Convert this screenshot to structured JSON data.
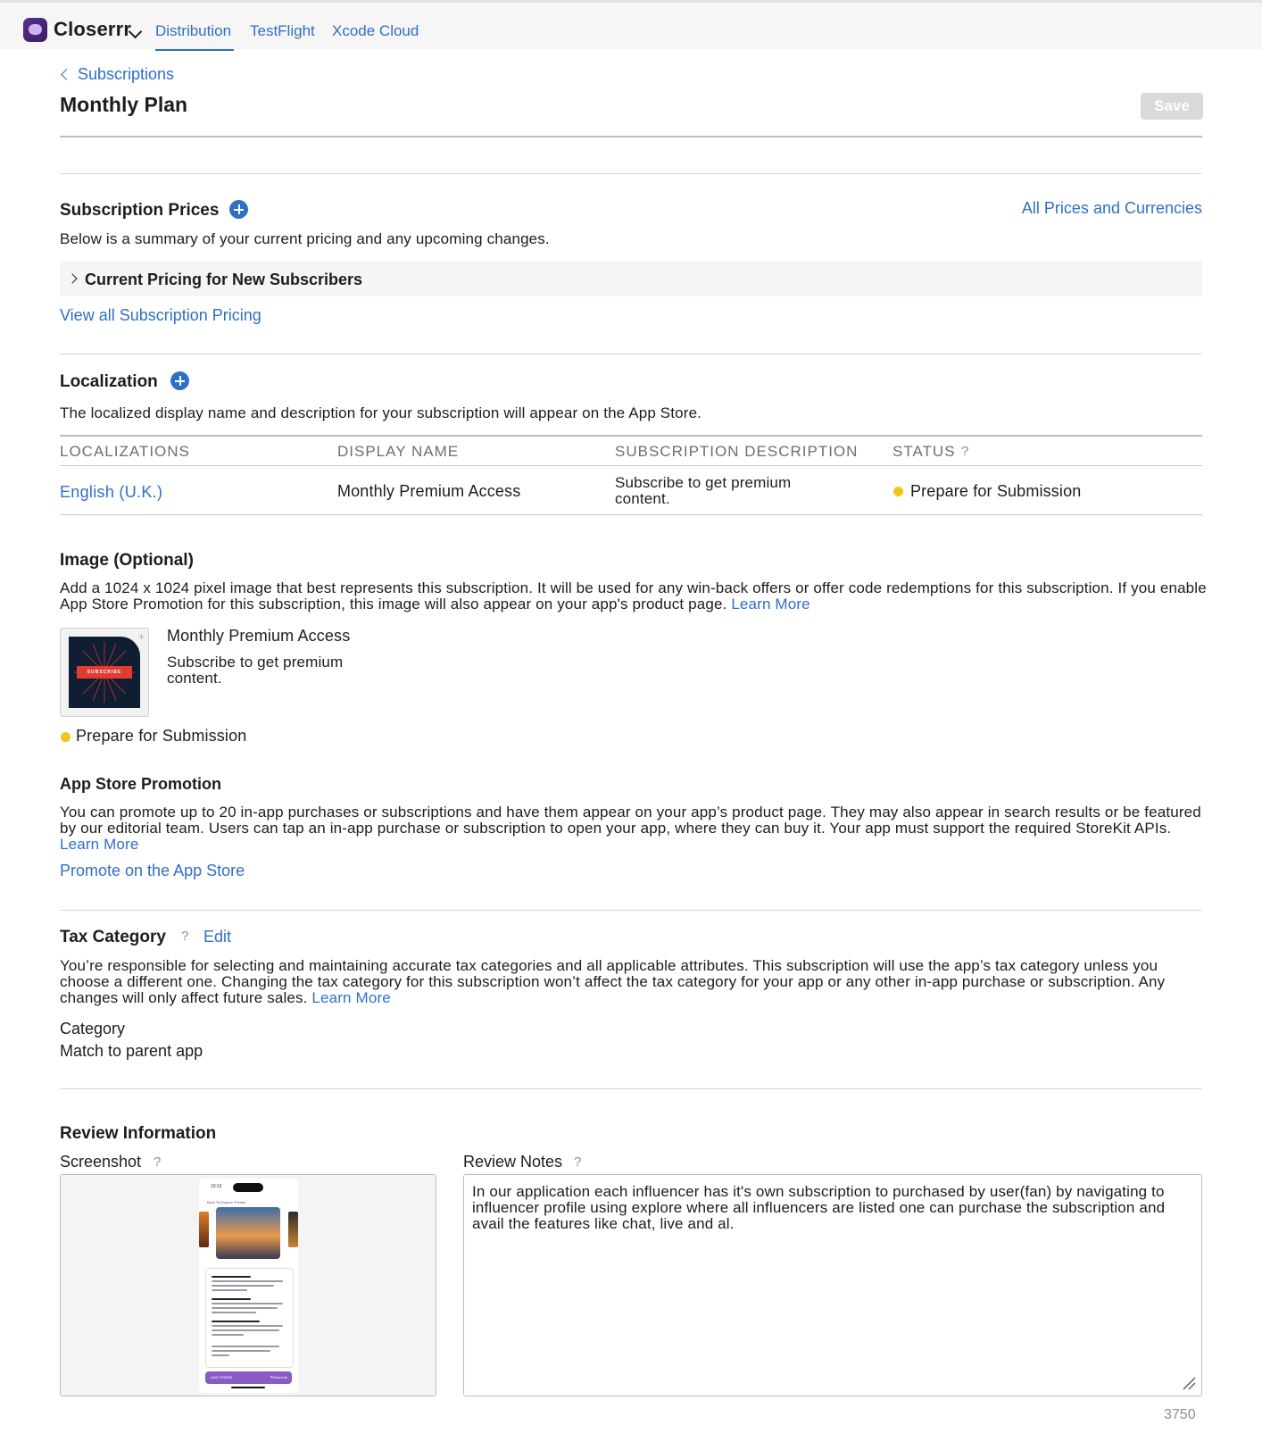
{
  "app": {
    "name": "Closerrr"
  },
  "nav": {
    "tabs": [
      {
        "label": "Distribution",
        "active": true
      },
      {
        "label": "TestFlight",
        "active": false
      },
      {
        "label": "Xcode Cloud",
        "active": false
      }
    ]
  },
  "header": {
    "breadcrumb": "Subscriptions",
    "title": "Monthly Plan",
    "save_label": "Save"
  },
  "prices": {
    "title": "Subscription Prices",
    "all_link": "All Prices and Currencies",
    "description": "Below is a summary of your current pricing and any upcoming changes.",
    "collapsible_label": "Current Pricing for New Subscribers",
    "view_all_link": "View all Subscription Pricing"
  },
  "localization": {
    "title": "Localization",
    "description": "The localized display name and description for your subscription will appear on the App Store.",
    "columns": [
      "LOCALIZATIONS",
      "DISPLAY NAME",
      "SUBSCRIPTION DESCRIPTION",
      "STATUS"
    ],
    "status_help": "?",
    "rows": [
      {
        "localization": "English (U.K.)",
        "display_name": "Monthly Premium Access",
        "description": "Subscribe to get premium content.",
        "status": "Prepare for Submission"
      }
    ]
  },
  "image": {
    "title": "Image (Optional)",
    "description": "Add a 1024 x 1024 pixel image that best represents this subscription. It will be used for any win-back offers or offer code redemptions for this subscription. If you enable App Store Promotion for this subscription, this image will also appear on your app's product page.",
    "learn_more": "Learn More",
    "thumbnail_text": "SUBSCRIBE",
    "item_title": "Monthly Premium Access",
    "item_description": "Subscribe to get premium content.",
    "status": "Prepare for Submission",
    "status_color": "#f0c419"
  },
  "promotion": {
    "title": "App Store Promotion",
    "description": "You can promote up to 20 in-app purchases or subscriptions and have them appear on your app’s product page. They may also appear in search results or be featured by our editorial team. Users can tap an in-app purchase or subscription to open your app, where they can buy it. Your app must support the required StoreKit APIs.",
    "learn_more": "Learn More",
    "promote_link": "Promote on the App Store"
  },
  "tax": {
    "title": "Tax Category",
    "help": "?",
    "edit": "Edit",
    "description": "You’re responsible for selecting and maintaining accurate tax categories and all applicable attributes. This subscription will use the app’s tax category unless you choose a different one. Changing the tax category for this subscription won’t affect the tax category for your app or any other in-app purchase or subscription. Any changes will only affect future sales.",
    "learn_more": "Learn More",
    "category_label": "Category",
    "category_value": "Match to parent app"
  },
  "review": {
    "title": "Review Information",
    "screenshot_label": "Screenshot",
    "notes_label": "Review Notes",
    "help": "?",
    "notes": "In our application each influencer has it's own subscription to purchased by user(fan) by navigating to influencer profile using explore where all influencers are listed one can purchase the subscription and avail the features like chat, live and al.",
    "char_count": "3750",
    "phone": {
      "time": "10:12",
      "back_label": "Back To Explore Friends",
      "button_label": "ADD FRIEND",
      "button_price": "₹99/month"
    }
  },
  "colors": {
    "accent": "#2f6fc5",
    "status_pending": "#f0c419",
    "save_disabled": "#d9d9d9"
  }
}
